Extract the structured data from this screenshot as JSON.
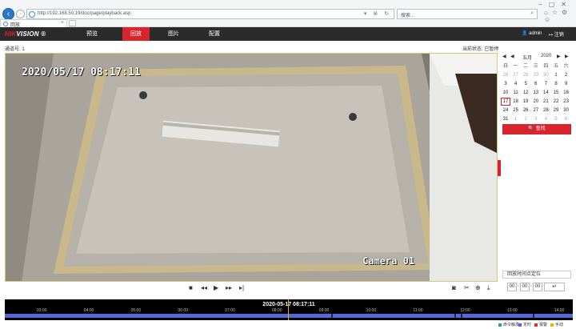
{
  "browser": {
    "url": "http://192.168.50.19/doc/page/playback.asp",
    "address_controls": "▾ ⊗ ↻",
    "search_placeholder": "搜索...",
    "tab_title": "回放",
    "toolbar_icons": "⌂☆⚙☺"
  },
  "header": {
    "logo": "HIKVISION",
    "logo_prefix": "HIK",
    "logo_suffix": "VISION ®",
    "menu": [
      {
        "label": "预览"
      },
      {
        "label": "回放",
        "active": true
      },
      {
        "label": "图片"
      },
      {
        "label": "配置"
      }
    ],
    "user": "admin",
    "logout": "注销",
    "accent_color": "#d9232d"
  },
  "status": {
    "channel_label": "通道号: 1",
    "state_label": "当前状态: 已暂停"
  },
  "video": {
    "osd_time": "2020/05/17 08:17:11",
    "osd_camera": "Camera 01"
  },
  "calendar": {
    "month": "五月",
    "year": "2020",
    "prev_year": "◀",
    "prev_month": "◀",
    "next_month": "▶",
    "next_year": "▶",
    "weekdays": [
      "日",
      "一",
      "二",
      "三",
      "四",
      "五",
      "六"
    ],
    "weeks": [
      [
        "26",
        "27",
        "28",
        "29",
        "30",
        "1",
        "2"
      ],
      [
        "3",
        "4",
        "5",
        "6",
        "7",
        "8",
        "9"
      ],
      [
        "10",
        "11",
        "12",
        "13",
        "14",
        "15",
        "16"
      ],
      [
        "17",
        "18",
        "19",
        "20",
        "21",
        "22",
        "23"
      ],
      [
        "24",
        "25",
        "26",
        "27",
        "28",
        "29",
        "30"
      ],
      [
        "31",
        "1",
        "2",
        "3",
        "4",
        "5",
        "6"
      ]
    ],
    "selected": "17"
  },
  "search_button": "查找",
  "locate": {
    "label": "回放时间点定位",
    "hh": "00",
    "mm": "00",
    "ss": "00",
    "go": "↵"
  },
  "timeline": {
    "current_time": "2020-05-17 08:17:11",
    "labels": [
      "03:00",
      "04:00",
      "05:00",
      "06:00",
      "07:00",
      "08:00",
      "09:00",
      "10:00",
      "11:00",
      "12:00",
      "13:00",
      "14:00"
    ]
  },
  "legend": [
    {
      "label": "命令触发",
      "color": "#2aa198"
    },
    {
      "label": "定时",
      "color": "#5468d9"
    },
    {
      "label": "报警",
      "color": "#e03030"
    },
    {
      "label": "手动",
      "color": "#e8b400"
    }
  ]
}
